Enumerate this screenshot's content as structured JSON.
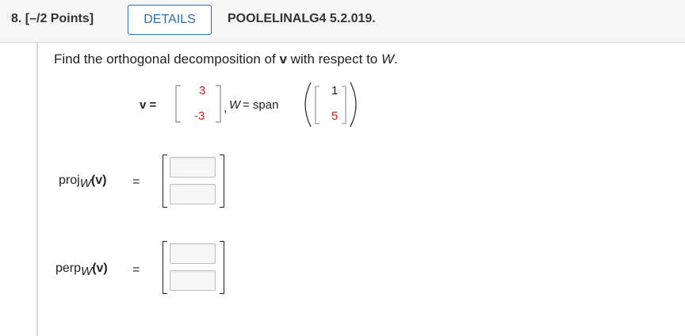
{
  "header": {
    "question_number": "8. [–/2 Points]",
    "details_label": "DETAILS",
    "question_id": "POOLELINALG4 5.2.019."
  },
  "problem": {
    "prompt_prefix": "Find the orthogonal decomposition of ",
    "prompt_v": "v",
    "prompt_middle": " with respect to ",
    "prompt_W": "W",
    "prompt_end": ".",
    "v_label": "v =",
    "v_entries": [
      "3",
      "-3"
    ],
    "comma": ",",
    "W_label": "W",
    "W_equals": "= span",
    "w_entries": [
      "1",
      "5"
    ]
  },
  "answers": {
    "proj_label": "proj",
    "proj_sub": "W",
    "proj_arg": "(v)",
    "proj_equals": "=",
    "perp_label": "perp",
    "perp_sub": "W",
    "perp_arg": "(v)",
    "perp_equals": "=",
    "proj_inputs": [
      "",
      ""
    ],
    "perp_inputs": [
      "",
      ""
    ]
  }
}
